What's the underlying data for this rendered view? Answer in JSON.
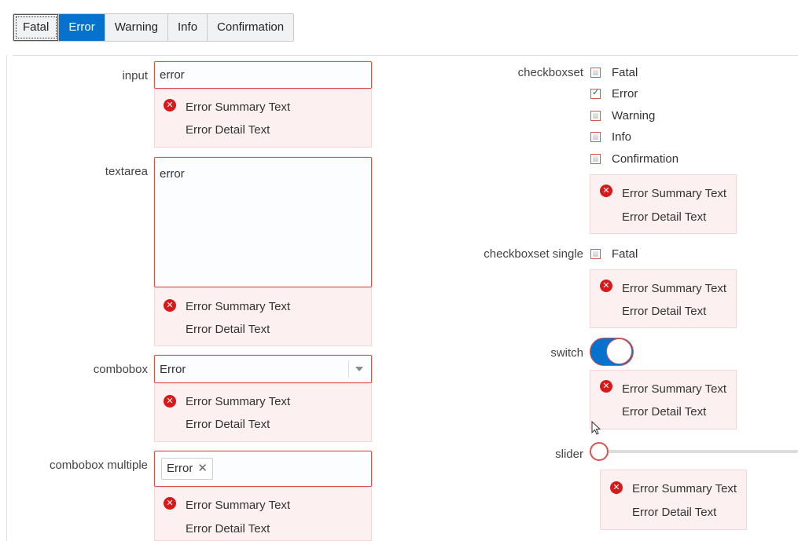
{
  "tabs": [
    "Fatal",
    "Error",
    "Warning",
    "Info",
    "Confirmation"
  ],
  "active_tab": "Error",
  "messages": {
    "summary": "Error Summary Text",
    "detail": "Error Detail Text"
  },
  "input": {
    "label": "input",
    "value": "error"
  },
  "textarea": {
    "label": "textarea",
    "value": "error"
  },
  "combobox": {
    "label": "combobox",
    "value": "Error"
  },
  "combobox_multiple": {
    "label": "combobox multiple",
    "chip": "Error",
    "chip_remove": "✕"
  },
  "checkboxset": {
    "label": "checkboxset",
    "options": [
      "Fatal",
      "Error",
      "Warning",
      "Info",
      "Confirmation"
    ],
    "checked": [
      "Error"
    ]
  },
  "checkboxset_single": {
    "label": "checkboxset single",
    "option": "Fatal"
  },
  "switch": {
    "label": "switch",
    "on": true
  },
  "slider": {
    "label": "slider",
    "value": 0
  },
  "colors": {
    "accent": "#0572ce",
    "error": "#d9534f",
    "error_bg": "#fcf0f1",
    "error_icon": "#d9181a"
  }
}
